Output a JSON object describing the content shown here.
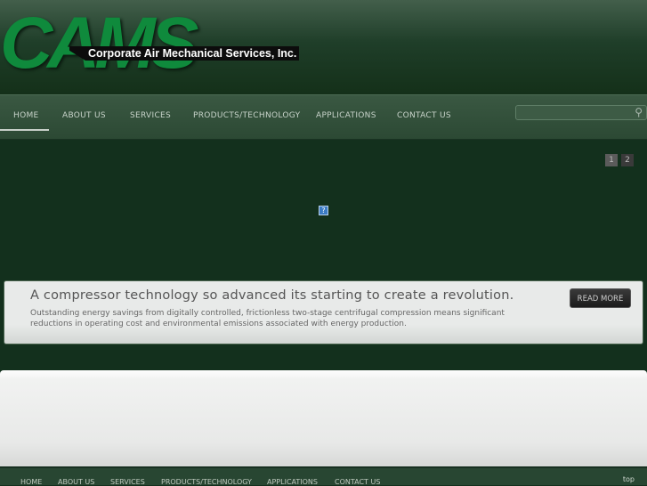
{
  "header": {
    "logo": "CAMS",
    "tagline": "Corporate Air Mechanical Services, Inc."
  },
  "nav": {
    "items": [
      "HOME",
      "ABOUT US",
      "SERVICES",
      "PRODUCTS/TECHNOLOGY",
      "APPLICATIONS",
      "CONTACT US"
    ],
    "active": "HOME",
    "search_placeholder": ""
  },
  "slider": {
    "pages": [
      "1",
      "2"
    ],
    "active_page": "1",
    "broken_image": "?",
    "caption_title": "A compressor technology so advanced its starting to create a revolution.",
    "caption_text": "Outstanding energy savings from digitally controlled, frictionless two-stage centrifugal compression means significant reductions in operating cost and environmental emissions associated with energy production.",
    "read_more": "READ MORE"
  },
  "footer": {
    "items": [
      "HOME",
      "ABOUT US",
      "SERVICES",
      "PRODUCTS/TECHNOLOGY",
      "APPLICATIONS",
      "CONTACT US"
    ],
    "top": "top"
  }
}
